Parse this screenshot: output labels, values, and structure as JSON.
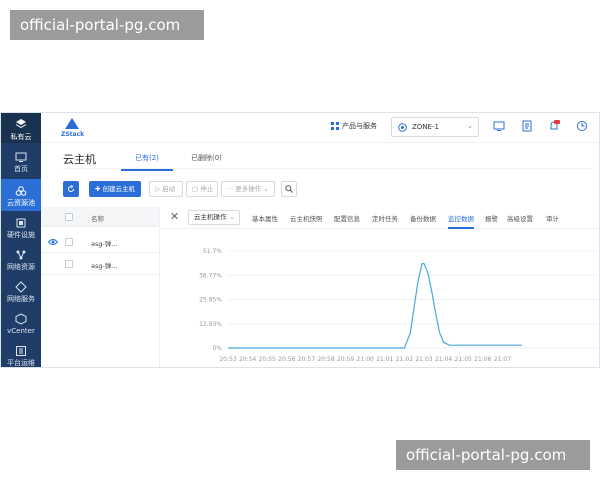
{
  "watermark": {
    "top": "official-portal-pg.com",
    "bottom": "official-portal-pg.com"
  },
  "sidebar": {
    "logo_label": "私有云",
    "items": [
      {
        "label": "首页",
        "icon": "dashboard-icon"
      },
      {
        "label": "云资源池",
        "icon": "cloud-pool-icon",
        "active": true
      },
      {
        "label": "硬件设施",
        "icon": "hardware-icon"
      },
      {
        "label": "网络资源",
        "icon": "network-resource-icon"
      },
      {
        "label": "网络服务",
        "icon": "network-service-icon"
      },
      {
        "label": "vCenter",
        "icon": "vcenter-icon"
      },
      {
        "label": "平台运维",
        "icon": "ops-icon"
      }
    ]
  },
  "header": {
    "brand": "ZStack",
    "products_label": "产品与服务",
    "zone": "ZONE-1"
  },
  "page": {
    "title": "云主机",
    "tabs": [
      {
        "label": "已有(2)",
        "active": true
      },
      {
        "label": "已删除(0)"
      }
    ]
  },
  "toolbar": {
    "create": "创建云主机",
    "start": "启动",
    "stop": "停止",
    "more": "更多操作"
  },
  "table": {
    "header_name": "名称",
    "rows": [
      {
        "name": "asg-弹..."
      },
      {
        "name": "asg-弹..."
      }
    ]
  },
  "detail": {
    "op_select": "云主机操作",
    "tabs": [
      "基本属性",
      "云主机快照",
      "配置信息",
      "定时任务",
      "备份数据",
      "监控数据",
      "报警",
      "高级设置",
      "审计"
    ],
    "active_tab": "监控数据"
  },
  "chart_data": {
    "type": "line",
    "title": "",
    "xlabel": "",
    "ylabel": "",
    "y_tick_labels": [
      "51.7%",
      "38.77%",
      "25.85%",
      "12.93%",
      "0%"
    ],
    "ylim": [
      0,
      51.7
    ],
    "x_tick_labels": [
      "20:53",
      "20:54",
      "20:55",
      "20:56",
      "20:57",
      "20:58",
      "20:59",
      "21:00",
      "21:01",
      "21:02",
      "21:03",
      "21:04",
      "21:05",
      "21:06",
      "21:07"
    ],
    "grid": true,
    "color": "#4aa8d8",
    "series": [
      {
        "x": [
          "20:53",
          "20:54",
          "20:55",
          "20:56",
          "20:57",
          "20:58",
          "20:59",
          "21:00",
          "21:01",
          "21:02",
          "21:02.3",
          "21:02.5",
          "21:02.7",
          "21:02.9",
          "21:03",
          "21:03.2",
          "21:03.4",
          "21:03.6",
          "21:03.8",
          "21:04",
          "21:04.3",
          "21:05",
          "21:06",
          "21:07",
          "21:08"
        ],
        "values": [
          0,
          0,
          0,
          0,
          0,
          0,
          0,
          0,
          0,
          0,
          8,
          22,
          36,
          45,
          45,
          40,
          30,
          18,
          8,
          3,
          1.5,
          1.5,
          1.5,
          1.5,
          1.5
        ]
      }
    ]
  },
  "colors": {
    "accent": "#2b6fd6",
    "sidebar": "#1f3d66",
    "series": "#4aa8d8"
  }
}
